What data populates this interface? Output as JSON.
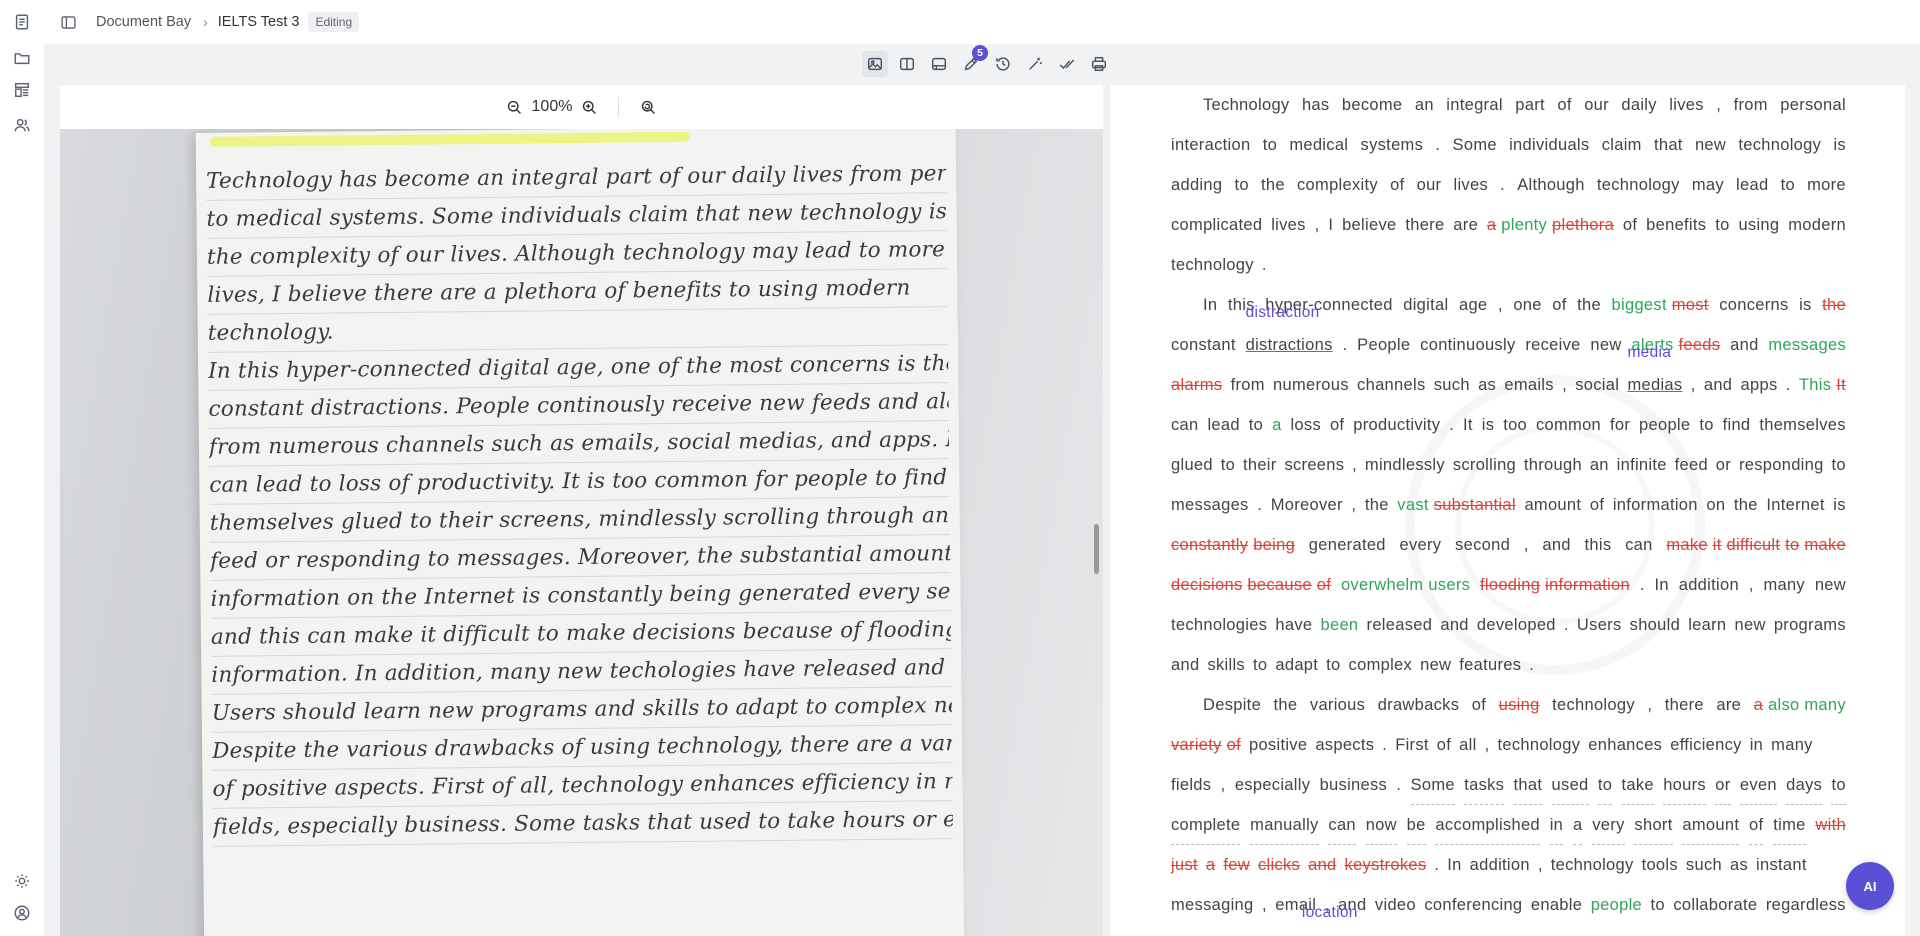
{
  "breadcrumb": {
    "root": "Document Bay",
    "current": "IELTS Test 3",
    "status": "Editing"
  },
  "toolbar": {
    "tools": [
      "image-view-icon",
      "split-view-icon",
      "layout-icon",
      "annotations-icon",
      "history-icon",
      "magic-wand-icon",
      "check-all-icon",
      "print-icon"
    ],
    "annotation_count": "5"
  },
  "viewer": {
    "zoom": "100%"
  },
  "handwriting": [
    "Technology has become an integral part of our daily lives from personal interaction",
    "to medical systems. Some individuals claim that new technology is adding to",
    "the complexity of our lives. Although technology may lead to more complicated",
    "lives, I believe there are a plethora of benefits to using modern",
    "technology.",
    "    In this hyper-connected digital age, one of the most concerns is the",
    "constant distractions. People continously receive new feeds and alarms",
    "from numerous channels such as emails, social medias, and apps. It",
    "can lead to loss of productivity. It is too common for people to find",
    "themselves glued to their screens, mindlessly scrolling through an infinite",
    "feed or responding to messages. Moreover, the substantial amount of",
    "information on the Internet is constantly being generated every second,",
    "and this can make it difficult to make decisions because of flooding",
    "information. In addition, many new techologies have released and developed.",
    "Users should learn new programs and skills to adapt to complex new features.",
    "    Despite the various drawbacks of using technology, there are a variety",
    "of positive aspects. First of all, technology enhances efficiency in many",
    "fields, especially business. Some tasks that used to take hours or even"
  ],
  "essay": {
    "notes": {
      "distraction": "distraction",
      "media": "media",
      "location": "location"
    }
  },
  "ai_button": "AI"
}
